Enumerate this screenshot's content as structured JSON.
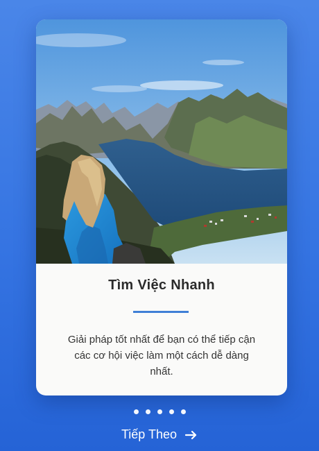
{
  "card": {
    "image_alt": "Woman in a blue jacket overlooking a mountain fjord",
    "title": "Tìm Việc Nhanh",
    "description": "Giải pháp tốt nhất để bạn có thể tiếp cận các cơ hội việc làm một cách dễ dàng nhất."
  },
  "pagination": {
    "total": 5,
    "dots": [
      "",
      "",
      "",
      "",
      ""
    ]
  },
  "next": {
    "label": "Tiếp Theo",
    "icon": "arrow-right-icon"
  },
  "colors": {
    "background_top": "#4a86e8",
    "background_bottom": "#2563d6",
    "accent": "#3f7fd6",
    "card": "#fafaf9"
  }
}
